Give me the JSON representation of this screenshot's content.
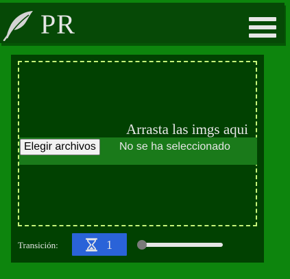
{
  "header": {
    "logo_icon": "feather-quill-icon",
    "brand": "PR",
    "menu_icon": "hamburger-menu-icon"
  },
  "dropzone": {
    "prompt": "Arrasta las imgs aqui",
    "file_button_label": "Elegir archivos",
    "file_status": "No se ha seleccionado"
  },
  "controls": {
    "transition_label": "Transición:",
    "transition_icon": "hourglass-icon",
    "transition_value": "1",
    "slider_level": 0
  },
  "colors": {
    "page_background": "#0d850d",
    "header_background": "#064906",
    "panel_background": "#014101",
    "dropzone_border": "#c6f57a",
    "accent_button": "#2a63d8",
    "text": "#e6e6e6"
  }
}
